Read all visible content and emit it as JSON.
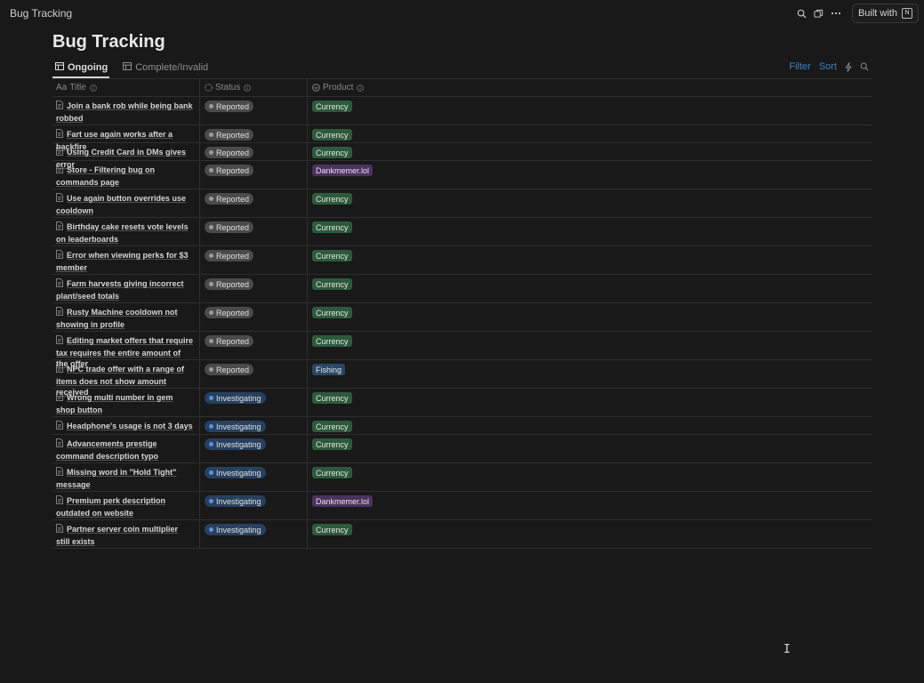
{
  "app": {
    "window_title": "Bug Tracking",
    "built_with_label": "Built with"
  },
  "page": {
    "title": "Bug Tracking"
  },
  "views": [
    {
      "label": "Ongoing",
      "active": true
    },
    {
      "label": "Complete/Invalid",
      "active": false
    }
  ],
  "actions": {
    "filter": "Filter",
    "sort": "Sort"
  },
  "columns": {
    "title": "Title",
    "title_prefix": "Aa",
    "status": "Status",
    "product": "Product"
  },
  "colors": {
    "background": "#191919",
    "reported": "#4a4a4a",
    "investigating": "#27405f",
    "currency": "#2d5a3c",
    "dankmemer": "#4b3160",
    "fishing": "#2a4666",
    "link": "#3b82c4"
  },
  "rows": [
    {
      "title": "Join a bank rob while being bank robbed",
      "status": "Reported",
      "product": "Currency"
    },
    {
      "title": "Fart use again works after a backfire",
      "status": "Reported",
      "product": "Currency"
    },
    {
      "title": "Using Credit Card in DMs gives error",
      "status": "Reported",
      "product": "Currency"
    },
    {
      "title": "Store - Filtering bug on commands page",
      "status": "Reported",
      "product": "Dankmemer.lol"
    },
    {
      "title": "Use again button overrides use cooldown",
      "status": "Reported",
      "product": "Currency"
    },
    {
      "title": "Birthday cake resets vote levels on leaderboards",
      "status": "Reported",
      "product": "Currency"
    },
    {
      "title": "Error when viewing perks for $3 member",
      "status": "Reported",
      "product": "Currency"
    },
    {
      "title": "Farm harvests giving incorrect plant/seed totals",
      "status": "Reported",
      "product": "Currency"
    },
    {
      "title": "Rusty Machine cooldown not showing in profile",
      "status": "Reported",
      "product": "Currency"
    },
    {
      "title": "Editing market offers that require tax requires the entire amount of the offer",
      "status": "Reported",
      "product": "Currency"
    },
    {
      "title": "NPC trade offer with a range of items does not show amount received",
      "status": "Reported",
      "product": "Fishing"
    },
    {
      "title": "Wrong multi number in gem shop button",
      "status": "Investigating",
      "product": "Currency"
    },
    {
      "title": "Headphone's usage is not 3 days",
      "status": "Investigating",
      "product": "Currency"
    },
    {
      "title": "Advancements prestige command description typo",
      "status": "Investigating",
      "product": "Currency"
    },
    {
      "title": "Missing word in \"Hold Tight\" message",
      "status": "Investigating",
      "product": "Currency"
    },
    {
      "title": "Premium perk description outdated on website",
      "status": "Investigating",
      "product": "Dankmemer.lol"
    },
    {
      "title": "Partner server coin multiplier still exists",
      "status": "Investigating",
      "product": "Currency"
    }
  ]
}
